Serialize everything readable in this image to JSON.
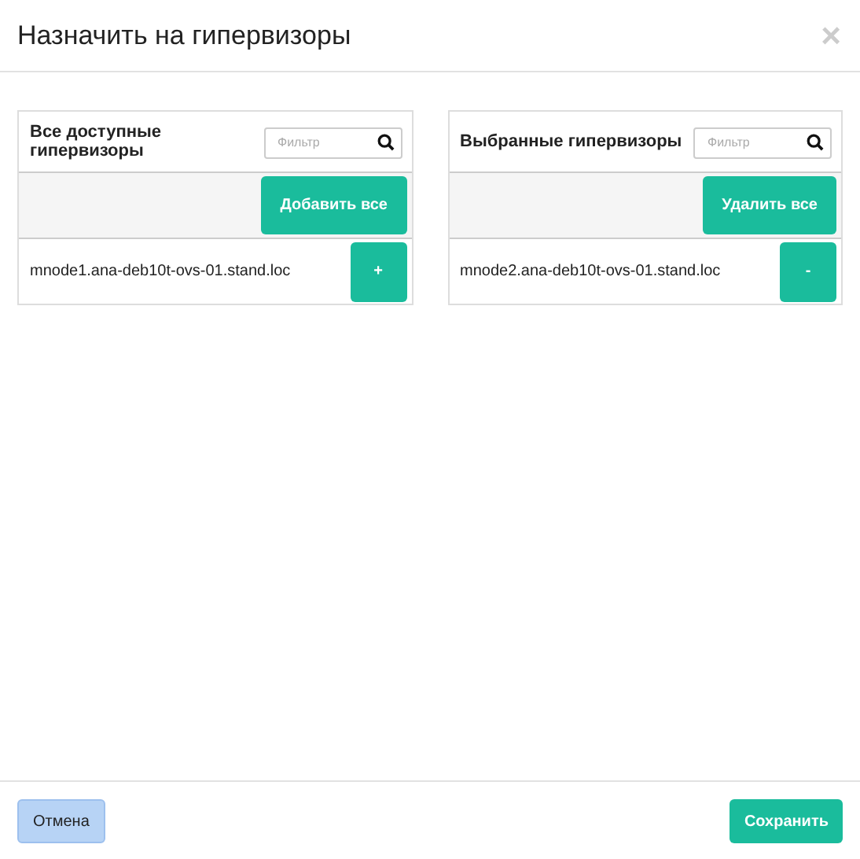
{
  "dialog": {
    "title": "Назначить на гипервизоры",
    "close": "×"
  },
  "panels": [
    {
      "title": "Все доступные гипервизоры",
      "filter_placeholder": "Фильтр",
      "bulk_button": "Добавить все",
      "items": [
        {
          "name": "mnode1.ana-deb10t-ovs-01.stand.loc",
          "action": "+"
        }
      ]
    },
    {
      "title": "Выбранные гипервизоры",
      "filter_placeholder": "Фильтр",
      "bulk_button": "Удалить все",
      "items": [
        {
          "name": "mnode2.ana-deb10t-ovs-01.stand.loc",
          "action": "-"
        }
      ]
    }
  ],
  "footer": {
    "cancel": "Отмена",
    "save": "Сохранить"
  }
}
